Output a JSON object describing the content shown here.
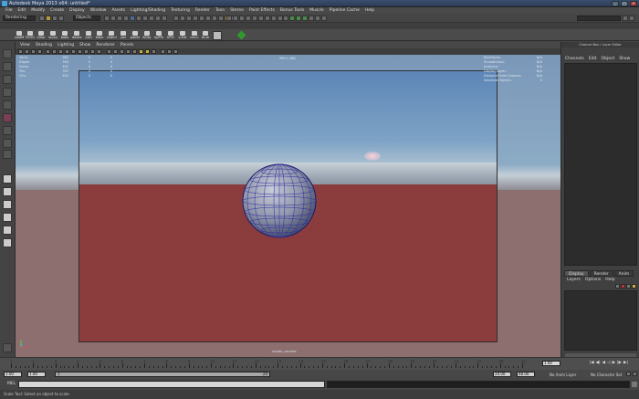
{
  "window": {
    "title": "Autodesk Maya 2013 x64: untitled*"
  },
  "menubar": [
    "File",
    "Edit",
    "Modify",
    "Create",
    "Display",
    "Window",
    "Assets",
    "Lighting/Shading",
    "Texturing",
    "Render",
    "Toon",
    "Stereo",
    "Paint Effects",
    "Bonus Tools",
    "Muscle",
    "Pipeline Cache",
    "Help"
  ],
  "statusline": {
    "mode": "Rendering",
    "selection_field": "Objects"
  },
  "shelf": {
    "items": [
      "castM",
      "FirOO",
      "vldur",
      "sccsv",
      "bobs",
      "doves",
      "uvin",
      "stars",
      "chami",
      "poi",
      "paifer",
      "KCity",
      "npPTs",
      "hPVr",
      "v-Ext",
      "mn-C",
      "dr;m"
    ]
  },
  "viewport": {
    "menu": [
      "View",
      "Shading",
      "Lighting",
      "Show",
      "Renderer",
      "Panels"
    ],
    "resolution": "960 x 486",
    "camera": "render_camera",
    "hud_left": [
      {
        "label": "Verts:",
        "v1": "382",
        "v2": "0",
        "v3": "0"
      },
      {
        "label": "Edges:",
        "v1": "764",
        "v2": "0",
        "v3": "0"
      },
      {
        "label": "Faces:",
        "v1": "401",
        "v2": "0",
        "v3": "0"
      },
      {
        "label": "Tris:",
        "v1": "762",
        "v2": "0",
        "v3": "0"
      },
      {
        "label": "UVs:",
        "v1": "442",
        "v2": "0",
        "v3": "0"
      }
    ],
    "hud_right": [
      {
        "label": "Backfaces:",
        "value": "N/A"
      },
      {
        "label": "Smoothness:",
        "value": "N/A"
      },
      {
        "label": "Instance:",
        "value": "N/A"
      },
      {
        "label": "Display Layer:",
        "value": "N/A"
      },
      {
        "label": "Distance From Camera:",
        "value": "N/A"
      },
      {
        "label": "Selected Objects:",
        "value": "0"
      }
    ]
  },
  "channelbox": {
    "title": "Channel Box / Layer Editor",
    "menu": [
      "Channels",
      "Edit",
      "Object",
      "Show"
    ],
    "layer_tabs": [
      "Display",
      "Render",
      "Anim"
    ],
    "layer_menu": [
      "Layers",
      "Options",
      "Help"
    ]
  },
  "timeline": {
    "ticks": [
      "1",
      "2",
      "3",
      "4",
      "5",
      "6",
      "7",
      "8",
      "9",
      "10",
      "11",
      "12",
      "13",
      "14",
      "15",
      "16",
      "17",
      "18",
      "19",
      "20",
      "21",
      "22",
      "23",
      "24"
    ],
    "current_frame": "1.00"
  },
  "range": {
    "start": "1.00",
    "start2": "1.00",
    "range_in": "1",
    "range_out": "24",
    "end": "24.00",
    "end2": "48.00",
    "anim_layer": "No Anim Layer",
    "char_set": "No Character Set"
  },
  "cmdline": {
    "label": "MEL"
  },
  "helpline": {
    "text": "Scale Tool: Select an object to scale."
  }
}
